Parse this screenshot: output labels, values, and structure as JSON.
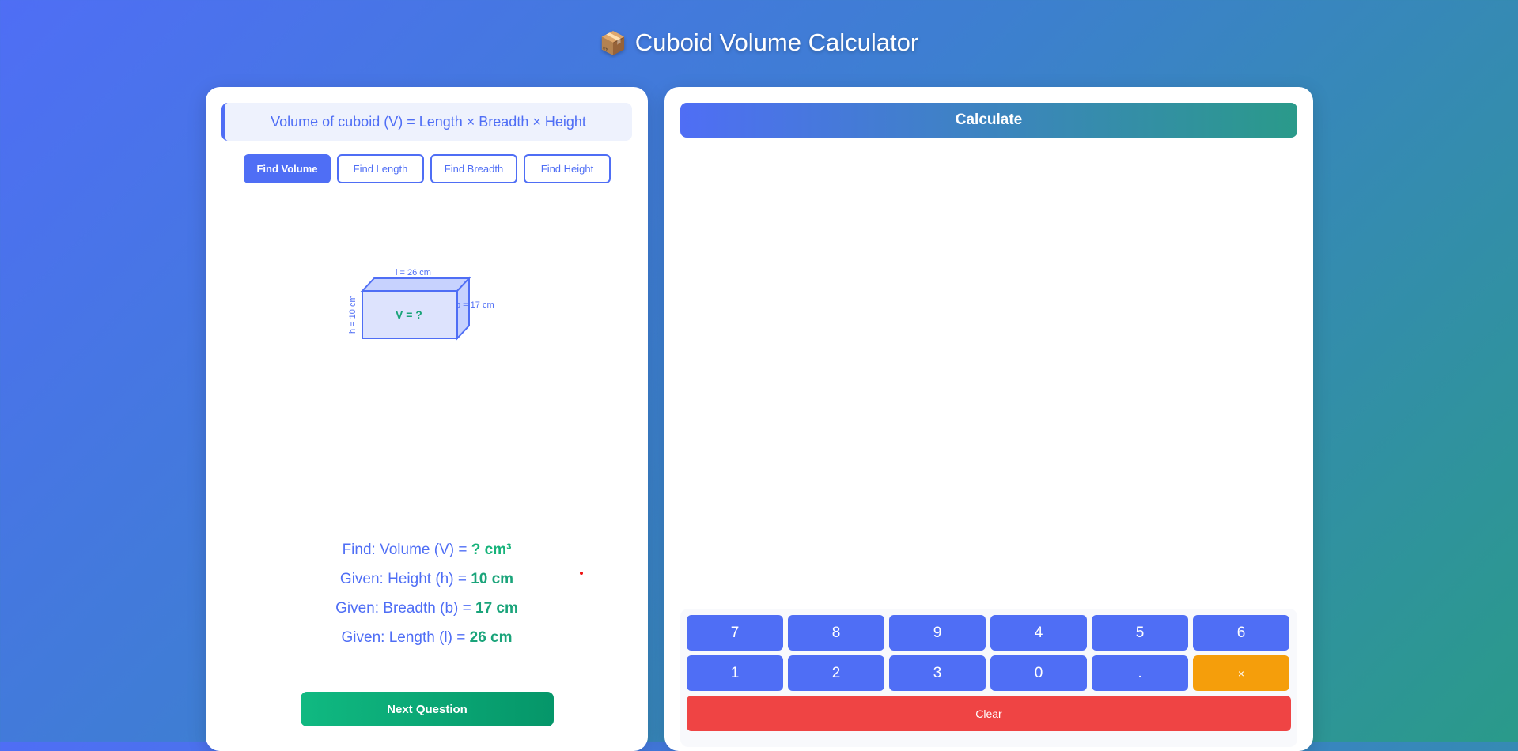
{
  "header": {
    "emoji": "📦",
    "title": "Cuboid Volume Calculator"
  },
  "left": {
    "formula": "Volume of cuboid (V) = Length × Breadth × Height",
    "modes": [
      "Find Volume",
      "Find Length",
      "Find Breadth",
      "Find Height"
    ],
    "active_mode": "Find Volume",
    "diagram": {
      "length_label": "l = 26 cm",
      "breadth_label": "b = 17 cm",
      "height_label": "h = 10 cm",
      "center_label": "V = ?"
    },
    "find": {
      "label": "Find: Volume (V) = ",
      "value": "? cm³"
    },
    "given_h": {
      "label": "Given: Height (h) = ",
      "value": "10 cm"
    },
    "given_b": {
      "label": "Given: Breadth (b) = ",
      "value": "17 cm"
    },
    "given_l": {
      "label": "Given: Length (l) = ",
      "value": "26 cm"
    },
    "next_label": "Next Question"
  },
  "right": {
    "calculate_label": "Calculate",
    "keys_row1": [
      "7",
      "8",
      "9",
      "4",
      "5",
      "6"
    ],
    "keys_row2": [
      "1",
      "2",
      "3",
      "0",
      ".",
      "×"
    ],
    "clear_label": "Clear"
  },
  "colors": {
    "primary": "#4f6ef5",
    "success": "#10b981",
    "danger": "#ef4444",
    "warning": "#f59e0b"
  }
}
